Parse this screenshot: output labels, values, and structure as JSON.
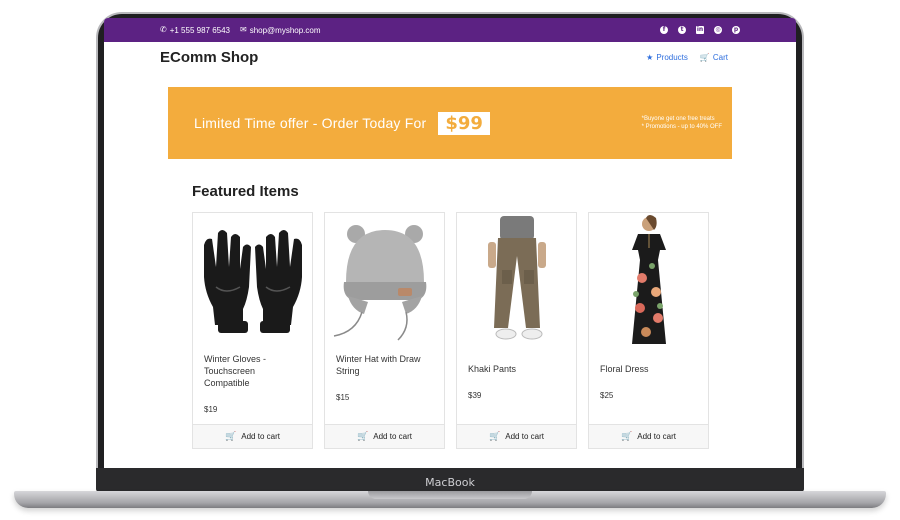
{
  "device": {
    "brand": "MacBook"
  },
  "topbar": {
    "phone": "+1 555 987 6543",
    "email": "shop@myshop.com",
    "social_icons": [
      "facebook-icon",
      "twitter-icon",
      "linkedin-icon",
      "dribbble-icon",
      "pinterest-icon"
    ]
  },
  "navbar": {
    "logo": "EComm Shop",
    "links": [
      {
        "label": "Products",
        "icon": "star-icon"
      },
      {
        "label": "Cart",
        "icon": "cart-icon"
      }
    ]
  },
  "banner": {
    "headline": "Limited Time offer - Order Today For",
    "price": "$99",
    "notes": [
      "*Buyone get one free treats",
      "* Promotions - up to 40% OFF"
    ],
    "color": "#f3ac3d"
  },
  "section": {
    "title": "Featured Items"
  },
  "products": [
    {
      "name": "Winter Gloves - Touchscreen Compatible",
      "price": "$19",
      "button": "Add to cart"
    },
    {
      "name": "Winter Hat with Draw String",
      "price": "$15",
      "button": "Add to cart"
    },
    {
      "name": "Khaki Pants",
      "price": "$39",
      "button": "Add to cart"
    },
    {
      "name": "Floral Dress",
      "price": "$25",
      "button": "Add to cart"
    }
  ],
  "colors": {
    "topbar": "#5c2283",
    "link": "#2f6fde",
    "accent": "#f3ac3d"
  }
}
